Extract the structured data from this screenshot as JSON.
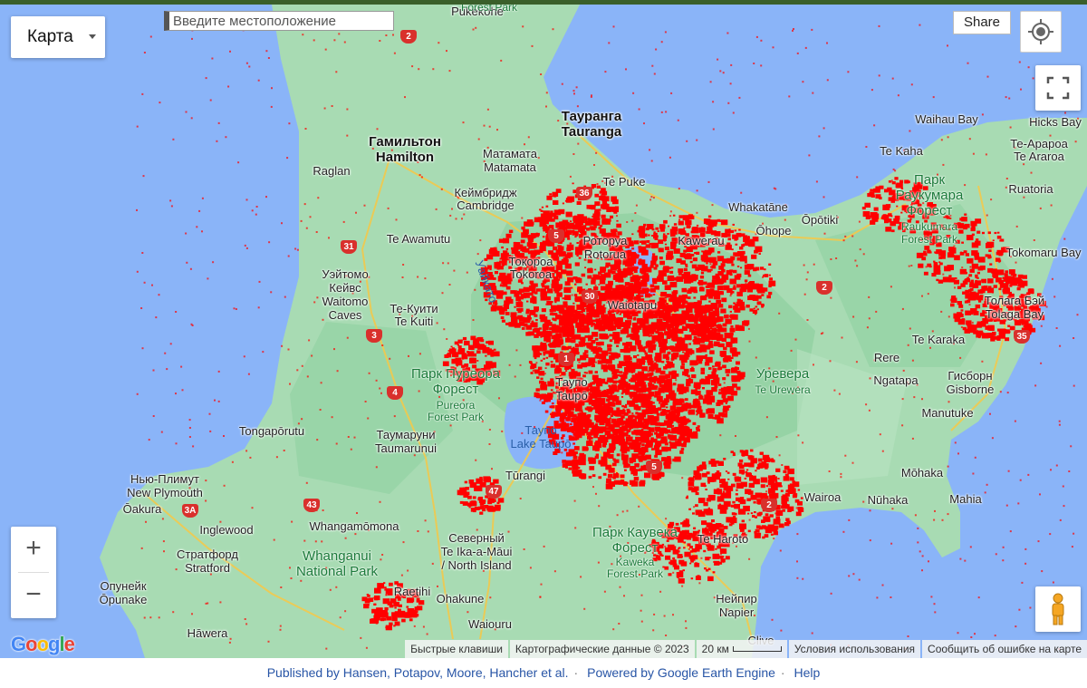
{
  "map_type": {
    "label": "Карта"
  },
  "search": {
    "placeholder": "Введите местоположение"
  },
  "share": {
    "label": "Share"
  },
  "zoom": {
    "in": "+",
    "out": "−"
  },
  "logo": "Google",
  "attribution": {
    "shortcuts": "Быстрые клавиши",
    "data": "Картографические данные © 2023",
    "scale": "20 км",
    "terms": "Условия использования",
    "report": "Сообщить об ошибке на карте"
  },
  "footer": {
    "published": "Published by Hansen, Potapov, Moore, Hancher et al.",
    "powered": "Powered by Google Earth Engine",
    "help": "Help"
  },
  "labels": {
    "pukekohe": "Pukekohe",
    "forest_park_top": "Forest Park",
    "hamilton_ru": "Гамильтон",
    "hamilton": "Hamilton",
    "raglan": "Raglan",
    "matamata_ru": "Матамата",
    "matamata": "Matamata",
    "tauranga_ru": "Тауранга",
    "tauranga": "Tauranga",
    "cambridge_ru": "Кеймбридж",
    "cambridge": "Cambridge",
    "te_puke": "Te Puke",
    "whakatane": "Whakatāne",
    "opotiki": "Ōpōtiki",
    "ohope": "Ōhope",
    "waihau_bay": "Waihau Bay",
    "hicks_bay": "Hicks Bay",
    "te_kaha": "Te Kaha",
    "te_araroa_ru": "Те-Арароа",
    "te_araroa": "Te Araroa",
    "ruatoria": "Ruatoria",
    "raukumara_ru1": "Парк",
    "raukumara_ru2": "Раукумара",
    "raukumara_ru3": "Форест",
    "raukumara1": "Raukumara",
    "raukumara2": "Forest Park",
    "te_awamutu": "Te Awamutu",
    "tokoroa_ru": "Токороа",
    "tokoroa": "Tokoroa",
    "rotorua_ru": "Роторуа",
    "rotorua": "Rotorua",
    "kawerau": "Kawerau",
    "tokomaru": "Tokomaru Bay",
    "waitomo_ru1": "Уэйтомо",
    "waitomo_ru2": "Кейвс",
    "waitomo1": "Waitomo",
    "waitomo2": "Caves",
    "te_kuiti_ru": "Те-Куити",
    "te_kuiti": "Te Kuiti",
    "waikato_river": "Уайкато",
    "waiotapu": "Waiotapu",
    "tolaga_ru": "Толага Бэй",
    "tolaga": "Tolaga Bay",
    "te_karaka": "Te Karaka",
    "rere": "Rere",
    "ngatapa": "Ngatapa",
    "gisborne_ru": "Гисборн",
    "gisborne": "Gisborne",
    "pureora_ru1": "Парк Пуреора",
    "pureora_ru2": "Форест",
    "pureora1": "Pureora",
    "pureora2": "Forest Park",
    "taupo_ru": "Таупо",
    "taupo": "Taupō",
    "urewera_ru": "Уревера",
    "urewera": "Te Urewera",
    "manutuke": "Manutuke",
    "tongaporutu": "Tongapōrutu",
    "taumarunui_ru": "Таумаруни",
    "taumarunui": "Taumarunui",
    "lake_taupo_ru": "Таупо",
    "lake_taupo": "Lake Taupō",
    "turangi": "Tūrangi",
    "mohaka": "Mōhaka",
    "mahia": "Mahia",
    "wairoa": "Wairoa",
    "nuhaka": "Nūhaka",
    "new_plymouth_ru": "Нью-Плимут",
    "new_plymouth": "New Plymouth",
    "oakura": "Ōakura",
    "inglewood": "Inglewood",
    "whangamomona": "Whangamōmona",
    "north_island_ru": "Северный",
    "te_ika": "Te Ika-a-Māui",
    "north_island": "/ North Island",
    "kaweka_ru1": "Парк Каувека",
    "kaweka_ru2": "Форест",
    "kaweka1": "Kaweka",
    "kaweka2": "Forest Park",
    "te_haroto": "Te Haroto",
    "stratford_ru": "Стратфорд",
    "stratford": "Stratford",
    "whanganui1": "Whanganui",
    "whanganui2": "National Park",
    "opunake_ru": "Опунейк",
    "opunake": "Ōpunake",
    "raetihi": "Raetihi",
    "ohakune": "Ohakune",
    "napier_ru": "Нейпир",
    "napier": "Napier",
    "hawera": "Hāwera",
    "waiouru": "Waiouru",
    "clive": "Clive"
  },
  "highways": [
    "2",
    "36",
    "5",
    "30",
    "31",
    "3",
    "4",
    "1",
    "47",
    "43",
    "3A",
    "35",
    "2",
    "5",
    "2"
  ],
  "colors": {
    "water": "#8ab4f8",
    "land": "#8fd3a0",
    "loss": "#ff0000",
    "road": "#f2c94c"
  }
}
